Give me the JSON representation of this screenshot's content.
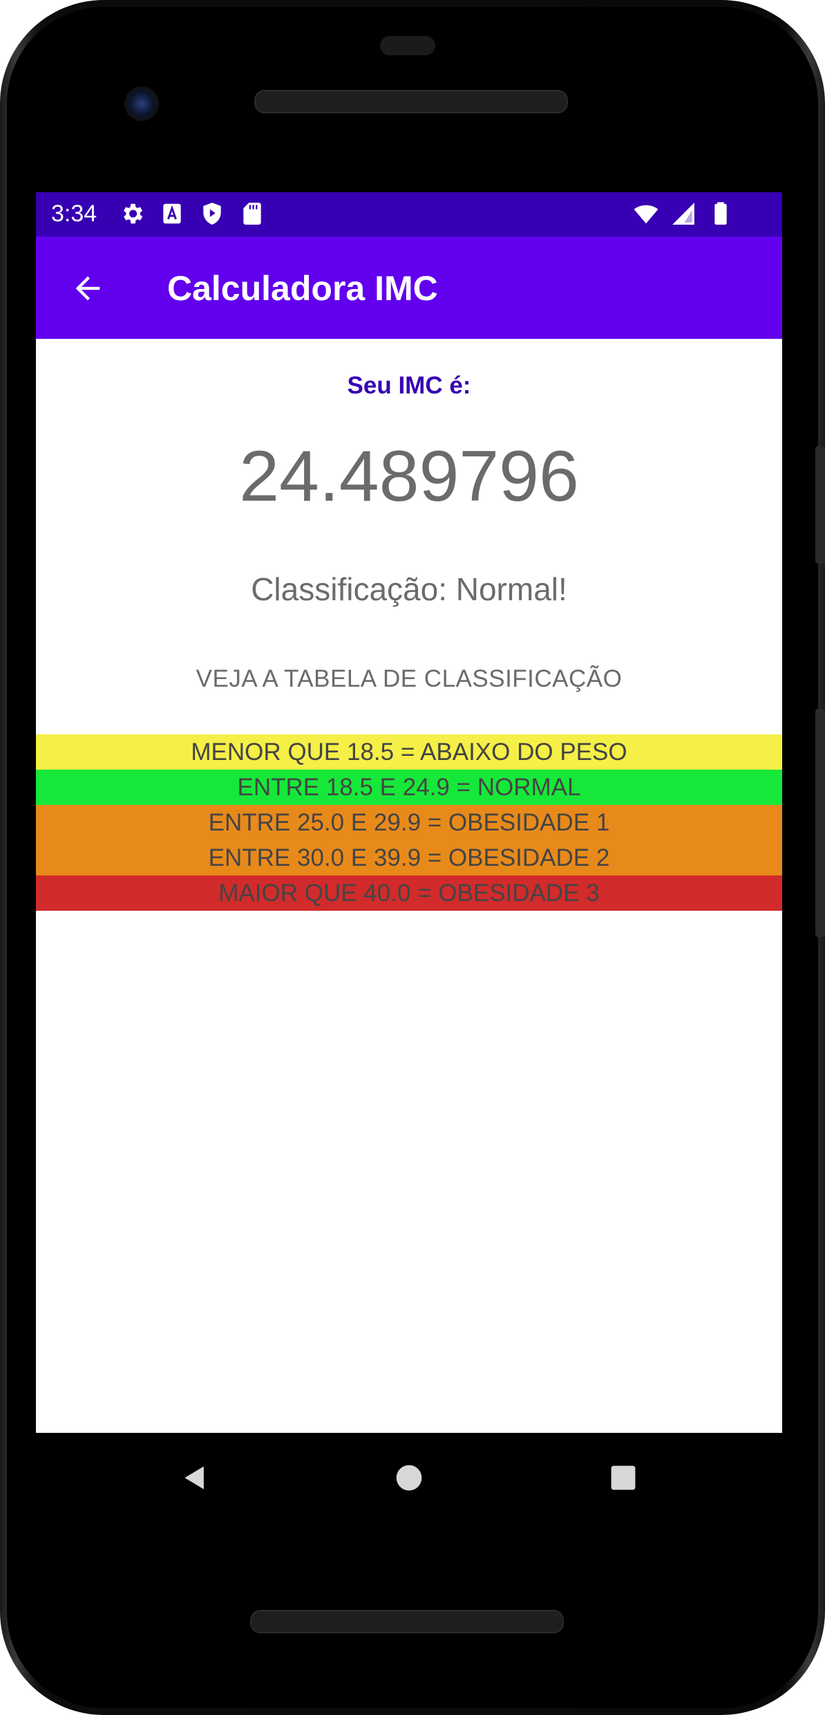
{
  "status_bar": {
    "time": "3:34",
    "left_icons": [
      "settings-icon",
      "font-icon",
      "shield-play-icon",
      "sd-card-icon"
    ],
    "right_icons": [
      "wifi-icon",
      "signal-icon",
      "battery-icon"
    ],
    "color": "#3700b3"
  },
  "app_bar": {
    "title": "Calculadora IMC",
    "back_icon": "arrow-back-icon",
    "color": "#6200ee"
  },
  "result": {
    "label": "Seu IMC é:",
    "value": "24.489796",
    "classification": "Classificação: Normal!"
  },
  "table_link": "VEJA A TABELA DE CLASSIFICAÇÃO",
  "bands": [
    {
      "label": "MENOR QUE 18.5 = ABAIXO DO PESO",
      "color": "#f5ef47"
    },
    {
      "label": "ENTRE 18.5 E 24.9 = NORMAL",
      "color": "#16e83a"
    },
    {
      "label": "ENTRE 25.0 E 29.9 = OBESIDADE 1",
      "color": "#e88a1a"
    },
    {
      "label": "ENTRE 30.0 E 39.9 = OBESIDADE 2",
      "color": "#e88a1a"
    },
    {
      "label": "MAIOR QUE 40.0 = OBESIDADE 3",
      "color": "#d12b2b"
    }
  ],
  "nav_bar": {
    "icons": [
      "nav-back-icon",
      "nav-home-icon",
      "nav-recents-icon"
    ]
  }
}
